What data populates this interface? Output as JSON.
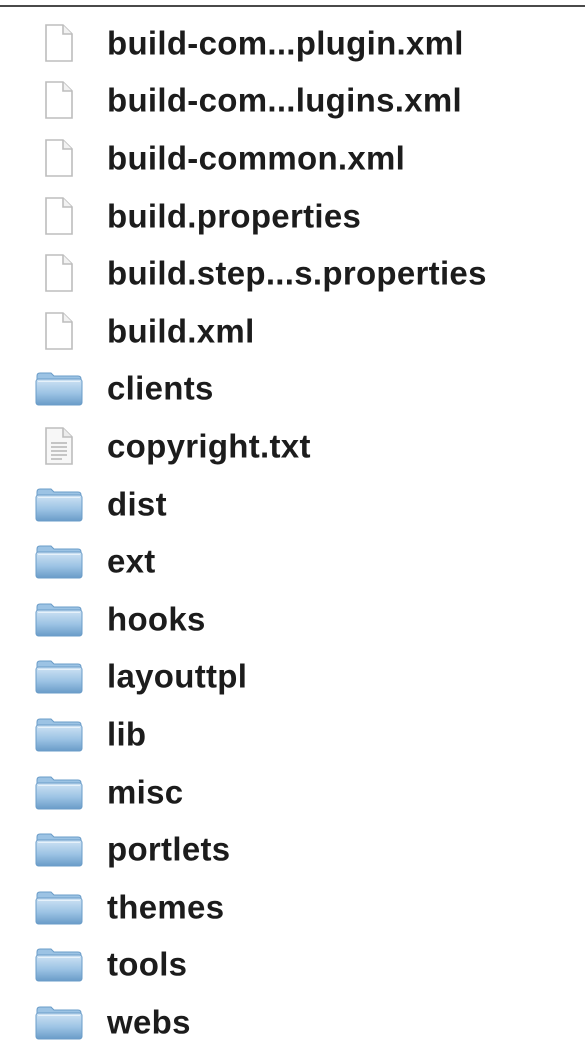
{
  "items": [
    {
      "name": "build-com...plugin.xml",
      "kind": "file",
      "icon": "document-icon"
    },
    {
      "name": "build-com...lugins.xml",
      "kind": "file",
      "icon": "document-icon"
    },
    {
      "name": "build-common.xml",
      "kind": "file",
      "icon": "document-icon"
    },
    {
      "name": "build.properties",
      "kind": "file",
      "icon": "document-icon"
    },
    {
      "name": "build.step...s.properties",
      "kind": "file",
      "icon": "document-icon"
    },
    {
      "name": "build.xml",
      "kind": "file",
      "icon": "document-icon"
    },
    {
      "name": "clients",
      "kind": "folder",
      "icon": "folder-icon"
    },
    {
      "name": "copyright.txt",
      "kind": "text",
      "icon": "text-document-icon"
    },
    {
      "name": "dist",
      "kind": "folder",
      "icon": "folder-icon"
    },
    {
      "name": "ext",
      "kind": "folder",
      "icon": "folder-icon"
    },
    {
      "name": "hooks",
      "kind": "folder",
      "icon": "folder-icon"
    },
    {
      "name": "layouttpl",
      "kind": "folder",
      "icon": "folder-icon"
    },
    {
      "name": "lib",
      "kind": "folder",
      "icon": "folder-icon"
    },
    {
      "name": "misc",
      "kind": "folder",
      "icon": "folder-icon"
    },
    {
      "name": "portlets",
      "kind": "folder",
      "icon": "folder-icon"
    },
    {
      "name": "themes",
      "kind": "folder",
      "icon": "folder-icon"
    },
    {
      "name": "tools",
      "kind": "folder",
      "icon": "folder-icon"
    },
    {
      "name": "webs",
      "kind": "folder",
      "icon": "folder-icon"
    }
  ],
  "colors": {
    "folder_light": "#cfe3f4",
    "folder_mid": "#9cc3e4",
    "folder_dark": "#6a9cc8",
    "document_stroke": "#bdbdbd",
    "text": "#1c1c1c"
  }
}
